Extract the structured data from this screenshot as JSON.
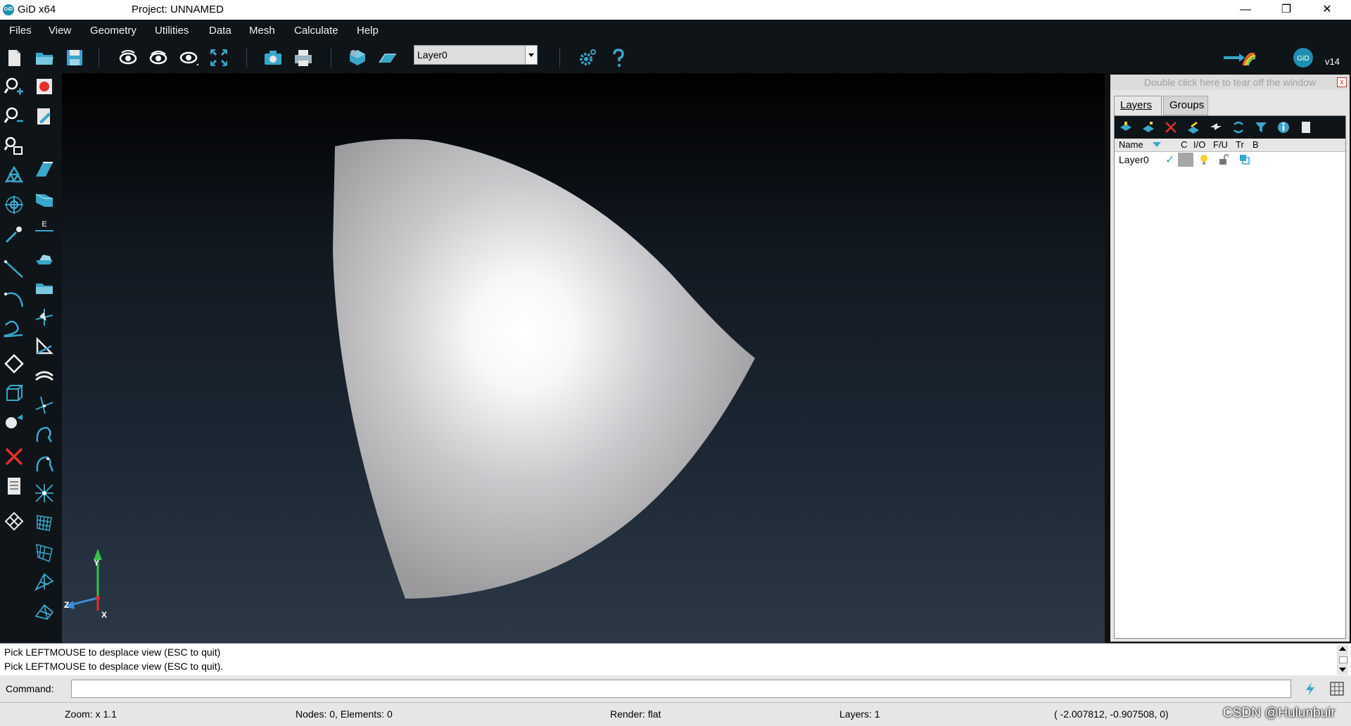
{
  "window": {
    "logo_text": "GiD",
    "app_name": "GiD x64",
    "project_title": "Project: UNNAMED",
    "minimize": "—",
    "restore": "❐",
    "close": "✕"
  },
  "menu": {
    "items": [
      "Files",
      "View",
      "Geometry",
      "Utilities",
      "Data",
      "Mesh",
      "Calculate",
      "Help"
    ]
  },
  "toolbar": {
    "layer_selected": "Layer0",
    "version": "v14",
    "logo_text": "GiD"
  },
  "panel": {
    "tearoff_text": "Double click here to tear off the window",
    "tabs": [
      "Layers",
      "Groups"
    ],
    "columns": [
      "Name",
      "C",
      "I/O",
      "F/U",
      "Tr",
      "B"
    ],
    "layers": [
      {
        "name": "Layer0"
      }
    ]
  },
  "axes": {
    "y": "Y",
    "z": "Z",
    "x": "X"
  },
  "console": {
    "lines": [
      "Pick LEFTMOUSE to desplace view (ESC to quit)",
      "Pick LEFTMOUSE to desplace view (ESC to quit)."
    ]
  },
  "command": {
    "label": "Command:",
    "value": ""
  },
  "status": {
    "zoom": "Zoom: x 1.1",
    "nodes": "Nodes: 0, Elements: 0",
    "render": "Render: flat",
    "layers": "Layers: 1",
    "coords": "( -2.007812, -0.907508,  0)"
  },
  "watermark": "CSDN @Hulunbuir",
  "colors": {
    "toolbar_bg": "#0f1419",
    "icon_teal": "#3aa6c8",
    "brand": "#1d8fb0",
    "viewport_top": "#000000",
    "viewport_bottom": "#2c3846"
  }
}
